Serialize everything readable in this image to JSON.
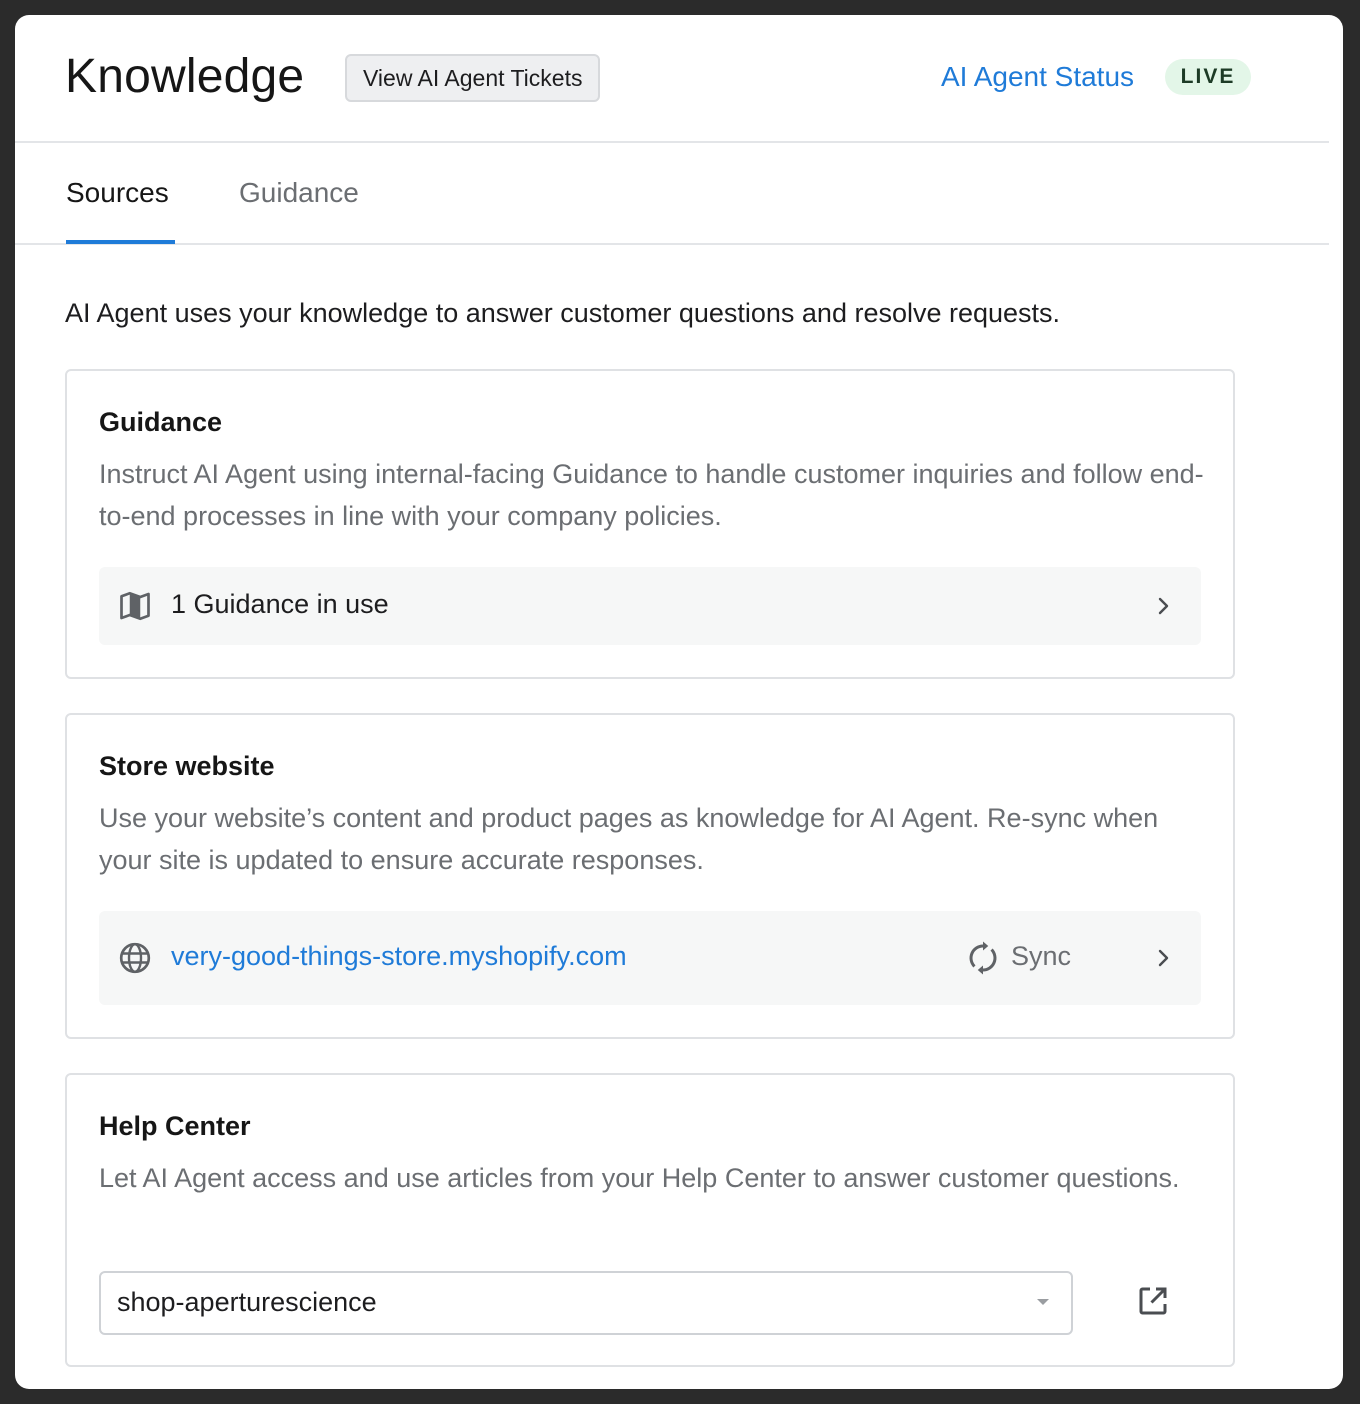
{
  "header": {
    "title": "Knowledge",
    "view_tickets_label": "View AI Agent Tickets",
    "status_link_label": "AI Agent Status",
    "status_badge": "LIVE"
  },
  "tabs": [
    {
      "label": "Sources",
      "active": true
    },
    {
      "label": "Guidance",
      "active": false
    }
  ],
  "intro": "AI Agent uses your knowledge to answer customer questions and resolve requests.",
  "cards": {
    "guidance": {
      "title": "Guidance",
      "description": "Instruct AI Agent using internal-facing Guidance to handle customer inquiries and follow end-to-end processes in line with your company policies.",
      "row_label": "1 Guidance in use",
      "row_icon": "map-icon"
    },
    "store_website": {
      "title": "Store website",
      "description": "Use your website’s content and product pages as knowledge for AI Agent. Re-sync when your site is updated to ensure accurate responses.",
      "url": "very-good-things-store.myshopify.com",
      "row_icon": "globe-icon",
      "sync_label": "Sync"
    },
    "help_center": {
      "title": "Help Center",
      "description": "Let AI Agent access and use articles from your Help Center to answer customer questions.",
      "selected": "shop-aperturescience"
    }
  },
  "colors": {
    "accent": "#1f7bd8",
    "live_badge_bg": "#e3f6e8",
    "row_bg": "#f6f7f7",
    "muted_text": "#6b6e72"
  }
}
